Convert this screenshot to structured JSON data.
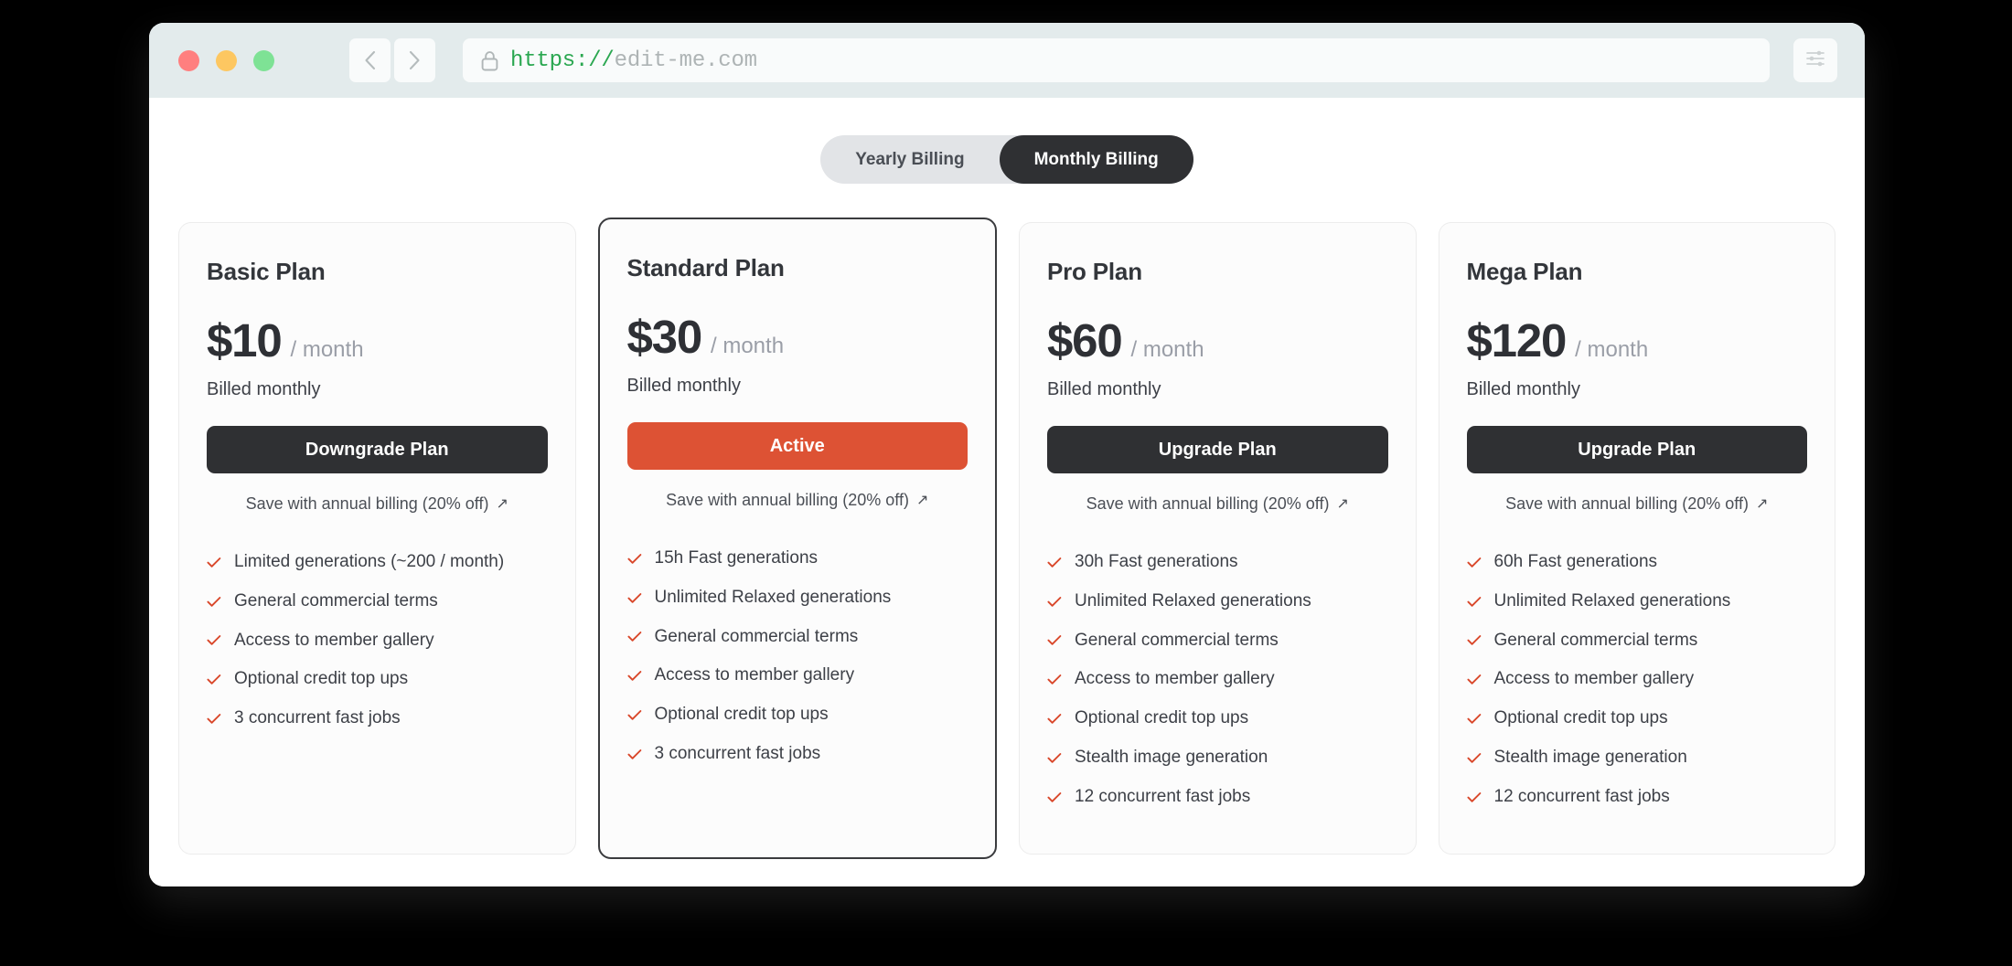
{
  "browser": {
    "traffic_lights": [
      "close",
      "minimize",
      "maximize"
    ],
    "back_label": "‹",
    "forward_label": "›",
    "url_scheme": "https://",
    "url_host": "edit-me.com",
    "url_full": "https://edit-me.com",
    "settings_icon": "sliders-icon",
    "lock_icon": "lock-icon",
    "colors": {
      "chrome_bg": "#E3EBEC",
      "dot_red": "#FF7F7F",
      "dot_yellow": "#FDC761",
      "dot_green": "#7EE295",
      "url_scheme_color": "#2AA750",
      "url_host_color": "#AEB4B5"
    }
  },
  "billing_toggle": {
    "options": [
      {
        "label": "Yearly Billing",
        "active": false
      },
      {
        "label": "Monthly Billing",
        "active": true
      }
    ]
  },
  "theme": {
    "accent": "#DD5234",
    "dark": "#2F3033",
    "check_color": "#D9472A",
    "card_bg": "#FCFCFC",
    "featured_border": "#3A3B3E"
  },
  "plans": [
    {
      "name": "Basic Plan",
      "price": "$10",
      "period": "/ month",
      "billed_note": "Billed monthly",
      "button_label": "Downgrade Plan",
      "button_style": "dark",
      "featured": false,
      "annual_link": "Save with annual billing (20% off)",
      "annual_link_arrow": "↗",
      "features": [
        "Limited generations (~200 / month)",
        "General commercial terms",
        "Access to member gallery",
        "Optional credit top ups",
        "3 concurrent fast jobs"
      ]
    },
    {
      "name": "Standard Plan",
      "price": "$30",
      "period": "/ month",
      "billed_note": "Billed monthly",
      "button_label": "Active",
      "button_style": "accent",
      "featured": true,
      "annual_link": "Save with annual billing (20% off)",
      "annual_link_arrow": "↗",
      "features": [
        "15h Fast generations",
        "Unlimited Relaxed generations",
        "General commercial terms",
        "Access to member gallery",
        "Optional credit top ups",
        "3 concurrent fast jobs"
      ]
    },
    {
      "name": "Pro Plan",
      "price": "$60",
      "period": "/ month",
      "billed_note": "Billed monthly",
      "button_label": "Upgrade Plan",
      "button_style": "dark",
      "featured": false,
      "annual_link": "Save with annual billing (20% off)",
      "annual_link_arrow": "↗",
      "features": [
        "30h Fast generations",
        "Unlimited Relaxed generations",
        "General commercial terms",
        "Access to member gallery",
        "Optional credit top ups",
        "Stealth image generation",
        "12 concurrent fast jobs"
      ]
    },
    {
      "name": "Mega Plan",
      "price": "$120",
      "period": "/ month",
      "billed_note": "Billed monthly",
      "button_label": "Upgrade Plan",
      "button_style": "dark",
      "featured": false,
      "annual_link": "Save with annual billing (20% off)",
      "annual_link_arrow": "↗",
      "features": [
        "60h Fast generations",
        "Unlimited Relaxed generations",
        "General commercial terms",
        "Access to member gallery",
        "Optional credit top ups",
        "Stealth image generation",
        "12 concurrent fast jobs"
      ]
    }
  ]
}
